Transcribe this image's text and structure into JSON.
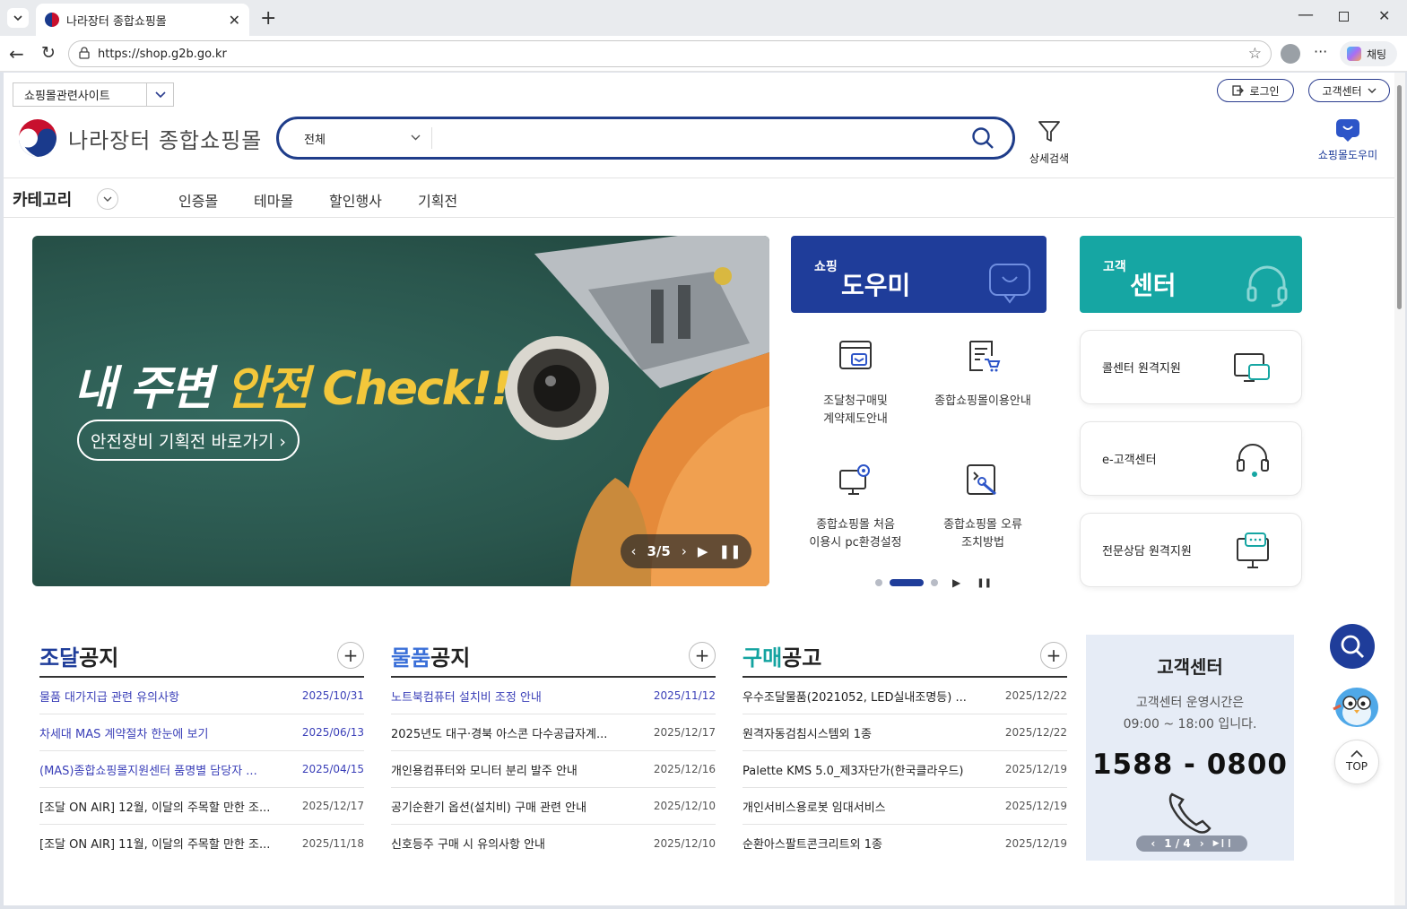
{
  "browser": {
    "tab_title": "나라장터 종합쇼핑몰",
    "url": "https://shop.g2b.go.kr",
    "copilot_label": "채팅"
  },
  "topbar": {
    "related_sites": "쇼핑몰관련사이트",
    "login": "로그인",
    "customer_center": "고객센터"
  },
  "header": {
    "logo_text": "나라장터 종합쇼핑몰",
    "search_category": "전체",
    "advanced_search": "상세검색",
    "shopping_helper": "쇼핑몰도우미"
  },
  "nav": {
    "category": "카테고리",
    "items": [
      "인증몰",
      "테마몰",
      "할인행사",
      "기획전"
    ]
  },
  "banner": {
    "headline_white": "내 주변 ",
    "headline_yellow1": "안전",
    "headline_yellow2": " Check!!",
    "cta": "안전장비 기획전 바로가기 ›",
    "counter": "3/5"
  },
  "helper_panel": {
    "small": "쇼핑",
    "big": "도우미",
    "items": [
      {
        "line1": "조달청구매및",
        "line2": "계약제도안내",
        "icon": "document-window-icon"
      },
      {
        "line1": "종합쇼핑몰이용안내",
        "line2": "",
        "icon": "cart-document-icon"
      },
      {
        "line1": "종합쇼핑몰 처음",
        "line2": "이용시 pc환경설정",
        "icon": "monitor-gear-icon"
      },
      {
        "line1": "종합쇼핑몰 오류",
        "line2": "조치방법",
        "icon": "wrench-document-icon"
      }
    ]
  },
  "customer_panel": {
    "small": "고객",
    "big": "센터",
    "cards": [
      "콜센터 원격지원",
      "e-고객센터",
      "전문상담 원격지원"
    ]
  },
  "lists": [
    {
      "title_accent": "조달",
      "title_rest": "공지",
      "accent_color": "#1f3d9a",
      "rows": [
        {
          "text": "물품 대가지급 관련 유의사항",
          "date": "2025/10/31",
          "hl": true
        },
        {
          "text": "차세대 MAS 계약절차 한눈에 보기",
          "date": "2025/06/13",
          "hl": true
        },
        {
          "text": "(MAS)종합쇼핑몰지원센터 품명별 담당자 ...",
          "date": "2025/04/15",
          "hl": true
        },
        {
          "text": "[조달 ON AIR] 12월, 이달의 주목할 만한 조...",
          "date": "2025/12/17",
          "hl": false
        },
        {
          "text": "[조달 ON AIR] 11월, 이달의 주목할 만한 조...",
          "date": "2025/11/18",
          "hl": false
        }
      ]
    },
    {
      "title_accent": "물품",
      "title_rest": "공지",
      "accent_color": "#3a6fd8",
      "rows": [
        {
          "text": "노트북컴퓨터 설치비 조정 안내",
          "date": "2025/11/12",
          "hl": true
        },
        {
          "text": "2025년도 대구·경북 아스콘 다수공급자계...",
          "date": "2025/12/17",
          "hl": false
        },
        {
          "text": "개인용컴퓨터와 모니터 분리 발주 안내",
          "date": "2025/12/16",
          "hl": false
        },
        {
          "text": "공기순환기 옵션(설치비) 구매 관련 안내",
          "date": "2025/12/10",
          "hl": false
        },
        {
          "text": "신호등주 구매 시 유의사항 안내",
          "date": "2025/12/10",
          "hl": false
        }
      ]
    },
    {
      "title_accent": "구매",
      "title_rest": "공고",
      "accent_color": "#13a3a0",
      "rows": [
        {
          "text": "우수조달물품(2021052, LED실내조명등) ...",
          "date": "2025/12/22",
          "hl": false
        },
        {
          "text": "원격자동검침시스템외 1종",
          "date": "2025/12/22",
          "hl": false
        },
        {
          "text": "Palette KMS 5.0_제3자단가(한국클라우드)",
          "date": "2025/12/19",
          "hl": false
        },
        {
          "text": "개인서비스용로봇 임대서비스",
          "date": "2025/12/19",
          "hl": false
        },
        {
          "text": "순환아스팔트콘크리트외 1종",
          "date": "2025/12/19",
          "hl": false
        }
      ]
    }
  ],
  "cs_box": {
    "title": "고객센터",
    "hours1": "고객센터 운영시간은",
    "hours2": "09:00 ~ 18:00 입니다.",
    "phone": "1588 - 0800",
    "pager": "1 / 4"
  },
  "floating": {
    "top": "TOP"
  },
  "colors": {
    "brand_navy": "#1f3d9a",
    "teal": "#16a6a3",
    "banner_green": "#2d5a52",
    "banner_yellow": "#f3c73b"
  }
}
